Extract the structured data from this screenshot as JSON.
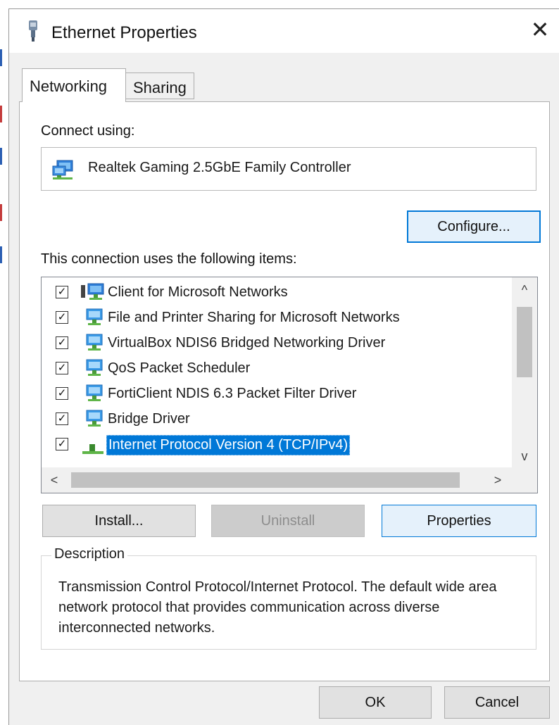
{
  "window": {
    "title": "Ethernet Properties",
    "close_glyph": "✕"
  },
  "tabs": [
    {
      "label": "Networking",
      "active": true
    },
    {
      "label": "Sharing",
      "active": false
    }
  ],
  "connect_using": {
    "label": "Connect using:",
    "adapter_name": "Realtek Gaming 2.5GbE Family Controller",
    "adapter_icon": "network-adapter-icon"
  },
  "buttons": {
    "configure": "Configure...",
    "install": "Install...",
    "uninstall": "Uninstall",
    "properties": "Properties",
    "ok": "OK",
    "cancel": "Cancel"
  },
  "items": {
    "label": "This connection uses the following items:",
    "list": [
      {
        "label": "Client for Microsoft Networks",
        "checked": true,
        "icon": "network-client-icon"
      },
      {
        "label": "File and Printer Sharing for Microsoft Networks",
        "checked": true,
        "icon": "network-service-icon"
      },
      {
        "label": "VirtualBox NDIS6 Bridged Networking Driver",
        "checked": true,
        "icon": "network-service-icon"
      },
      {
        "label": "QoS Packet Scheduler",
        "checked": true,
        "icon": "network-service-icon"
      },
      {
        "label": "FortiClient NDIS 6.3 Packet Filter Driver",
        "checked": true,
        "icon": "network-service-icon"
      },
      {
        "label": "Bridge Driver",
        "checked": true,
        "icon": "network-service-icon"
      },
      {
        "label": "Internet Protocol Version 4 (TCP/IPv4)",
        "checked": true,
        "selected": true,
        "icon": "network-protocol-icon"
      }
    ],
    "check_glyph": "✓",
    "scroll_up": "^",
    "scroll_down": "v",
    "scroll_left": "<",
    "scroll_right": ">"
  },
  "description": {
    "legend": "Description",
    "text": "Transmission Control Protocol/Internet Protocol. The default wide area network protocol that provides communication across diverse interconnected networks."
  },
  "colors": {
    "accent": "#0078d7",
    "selection": "#0078d7",
    "window_bg": "#f0f0f0"
  }
}
